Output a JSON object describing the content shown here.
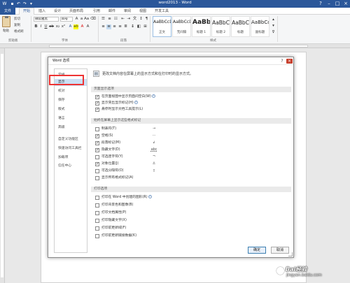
{
  "window": {
    "title": "word2013 - Word"
  },
  "ribbon_tabs": {
    "file": "文件",
    "items": [
      "开始",
      "插入",
      "设计",
      "页面布局",
      "引用",
      "邮件",
      "审阅",
      "视图",
      "开发工具"
    ]
  },
  "ribbon": {
    "clipboard": {
      "paste": "粘贴",
      "cut": "剪切",
      "copy": "复制",
      "painter": "格式刷",
      "label": "剪贴板"
    },
    "font": {
      "name": "微软雅黑",
      "size": "四号",
      "label": "字体"
    },
    "paragraph": {
      "label": "段落"
    },
    "styles": {
      "label": "样式",
      "items": [
        {
          "sample": "AaBbCcDd",
          "name": "正文"
        },
        {
          "sample": "AaBbCcDd",
          "name": "无间隔"
        },
        {
          "sample": "AaBb",
          "name": "标题 1"
        },
        {
          "sample": "AaBbC",
          "name": "标题 2"
        },
        {
          "sample": "AaBbC",
          "name": "标题"
        },
        {
          "sample": "AaBbCc",
          "name": "副标题"
        }
      ]
    }
  },
  "dialog": {
    "title": "Word 选项",
    "nav": [
      "常规",
      "显示",
      "校对",
      "保存",
      "版式",
      "语言",
      "高级",
      "自定义功能区",
      "快速访问工具栏",
      "加载项",
      "信任中心"
    ],
    "selected": "显示",
    "header": "更改文档内容在屏幕上的显示方式和在打印时的显示方式。",
    "sections": {
      "page_display": {
        "title": "页面显示选项",
        "options": [
          {
            "label": "在页面视图中显示页面间空白(W)",
            "checked": true,
            "info": true
          },
          {
            "label": "显示突出显示标记(H)",
            "checked": true,
            "info": true
          },
          {
            "label": "悬停时显示文档工具提示(L)",
            "checked": true,
            "info": false
          }
        ]
      },
      "format_marks": {
        "title": "始终在屏幕上显示这些格式标记",
        "options": [
          {
            "label": "制表符(T)",
            "symbol": "→",
            "checked": false
          },
          {
            "label": "空格(S)",
            "symbol": "···",
            "checked": true
          },
          {
            "label": "段落标记(M)",
            "symbol": "↲",
            "checked": true
          },
          {
            "label": "隐藏文字(D)",
            "symbol": "abc",
            "checked": true
          },
          {
            "label": "可选连字符(Y)",
            "symbol": "¬",
            "checked": false
          },
          {
            "label": "对象位置(J)",
            "symbol": "⚓",
            "checked": true
          },
          {
            "label": "可选分隔符(O)",
            "symbol": "▯",
            "checked": false
          },
          {
            "label": "显示所有格式标记(A)",
            "symbol": "",
            "checked": false
          }
        ]
      },
      "print": {
        "title": "打印选项",
        "options": [
          {
            "label": "打印在 Word 中创建的图形(R)",
            "checked": false,
            "info": true
          },
          {
            "label": "打印背景色和图像(B)",
            "checked": false,
            "info": false
          },
          {
            "label": "打印文档属性(P)",
            "checked": false,
            "info": false
          },
          {
            "label": "打印隐藏文字(X)",
            "checked": false,
            "info": false
          },
          {
            "label": "打印前更新域(F)",
            "checked": false,
            "info": false
          },
          {
            "label": "打印前更新链接数据(K)",
            "checked": false,
            "info": false
          }
        ]
      }
    },
    "ok": "确定",
    "cancel": "取消"
  },
  "watermark": {
    "line1": "Bai经验",
    "line2": "jingyan.baidu.com"
  }
}
